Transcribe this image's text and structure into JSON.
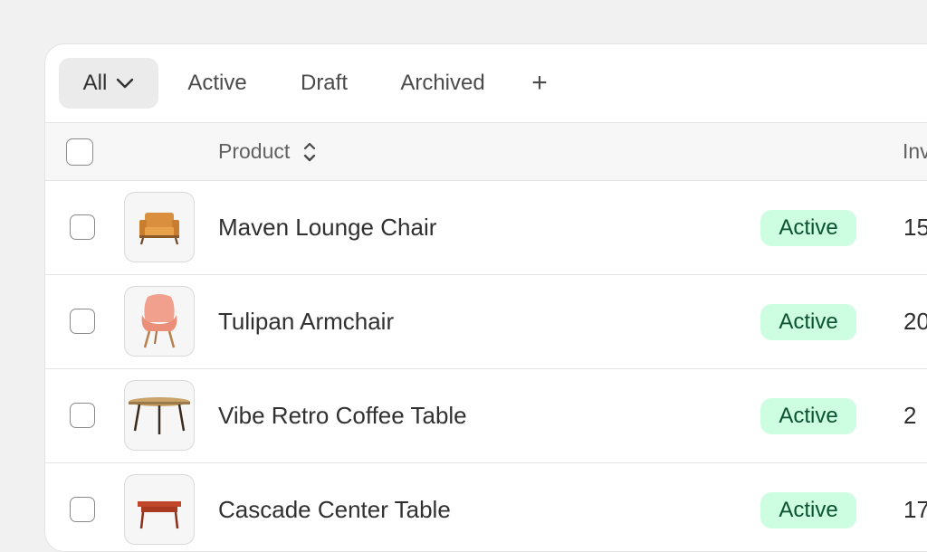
{
  "tabs": [
    {
      "label": "All",
      "selected": true,
      "icon": "chevron-down-icon"
    },
    {
      "label": "Active"
    },
    {
      "label": "Draft"
    },
    {
      "label": "Archived"
    },
    {
      "label": "+"
    }
  ],
  "table": {
    "columns": [
      "Product",
      "Inv"
    ],
    "rows": [
      {
        "name": "Maven Lounge Chair",
        "status": "Active",
        "inventory": "15",
        "thumb": "lounge-chair-image"
      },
      {
        "name": "Tulipan Armchair",
        "status": "Active",
        "inventory": "20",
        "thumb": "armchair-image"
      },
      {
        "name": "Vibe Retro Coffee Table",
        "status": "Active",
        "inventory": "2",
        "thumb": "coffee-table-image"
      },
      {
        "name": "Cascade Center Table",
        "status": "Active",
        "inventory": "17",
        "thumb": "center-table-image"
      }
    ]
  },
  "colors": {
    "page_bg": "#f1f1f1",
    "badge_bg": "#cdfee1",
    "badge_text": "#0c5132",
    "selected_tab_bg": "#ebebeb"
  }
}
